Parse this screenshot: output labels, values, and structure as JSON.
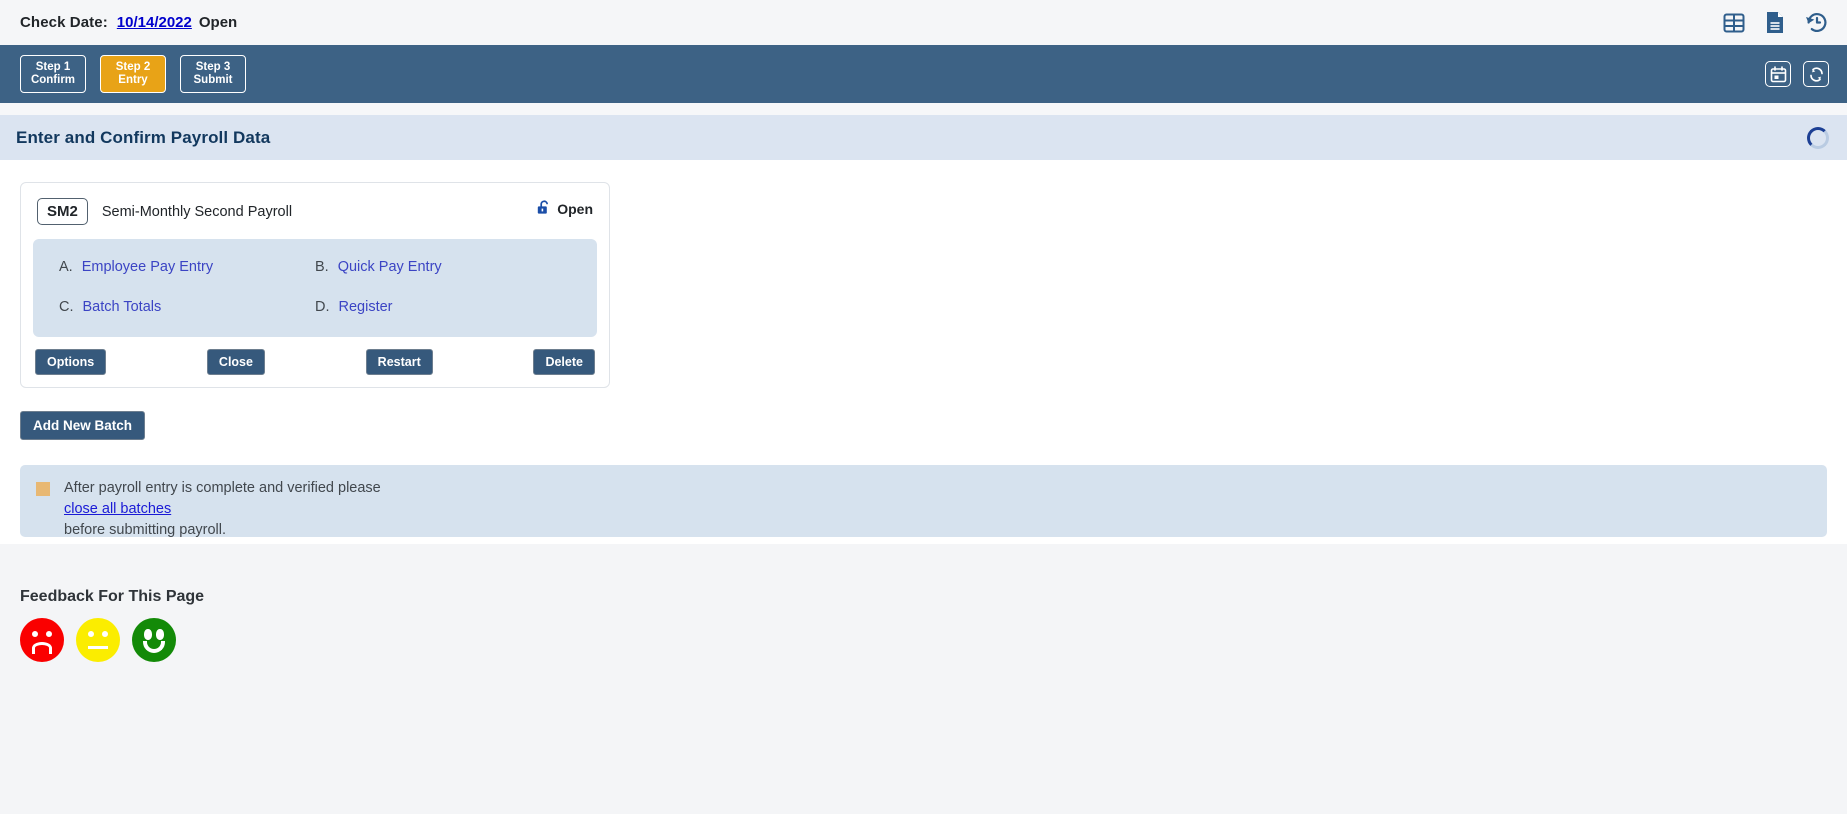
{
  "topbar": {
    "check_date_label": "Check Date:",
    "check_date_value": "10/14/2022",
    "status": "Open",
    "icons": [
      {
        "name": "grid-table-icon",
        "title": "Grid"
      },
      {
        "name": "document-icon",
        "title": "Document"
      },
      {
        "name": "history-icon",
        "title": "History"
      }
    ]
  },
  "steps": [
    {
      "line1": "Step 1",
      "line2": "Confirm",
      "active": false
    },
    {
      "line1": "Step 2",
      "line2": "Entry",
      "active": true
    },
    {
      "line1": "Step 3",
      "line2": "Submit",
      "active": false
    }
  ],
  "stepbar_icons": [
    {
      "name": "calendar-icon",
      "title": "Calendar"
    },
    {
      "name": "refresh-icon",
      "title": "Refresh"
    }
  ],
  "section": {
    "title": "Enter and Confirm Payroll Data",
    "spinner": "loading-spinner"
  },
  "batch": {
    "code": "SM2",
    "name": "Semi-Monthly Second Payroll",
    "status": "Open",
    "status_icon": "unlocked-padlock-icon",
    "links": [
      {
        "letter": "A.",
        "label": "Employee Pay Entry"
      },
      {
        "letter": "B.",
        "label": "Quick Pay Entry"
      },
      {
        "letter": "C.",
        "label": "Batch Totals"
      },
      {
        "letter": "D.",
        "label": "Register"
      }
    ],
    "buttons": [
      {
        "label": "Options"
      },
      {
        "label": "Close"
      },
      {
        "label": "Restart"
      },
      {
        "label": "Delete"
      }
    ]
  },
  "add_new_batch": "Add New Batch",
  "notice": {
    "line1": "After payroll entry is complete and verified please",
    "link": "close all batches",
    "line3": "before submitting payroll."
  },
  "feedback": {
    "title": "Feedback For This Page",
    "faces": [
      {
        "name": "feedback-negative",
        "mood": "sad"
      },
      {
        "name": "feedback-neutral",
        "mood": "neutral"
      },
      {
        "name": "feedback-positive",
        "mood": "happy"
      }
    ]
  },
  "colors": {
    "step_bar": "#3d6285",
    "active_step": "#e8a317",
    "section_head": "#dbe4f1",
    "panel_blue": "#d6e2ee",
    "button_dark": "#36597c",
    "link": "#3b44c4",
    "negative": "#fa0000",
    "neutral": "#fbed00",
    "positive": "#138a08"
  }
}
